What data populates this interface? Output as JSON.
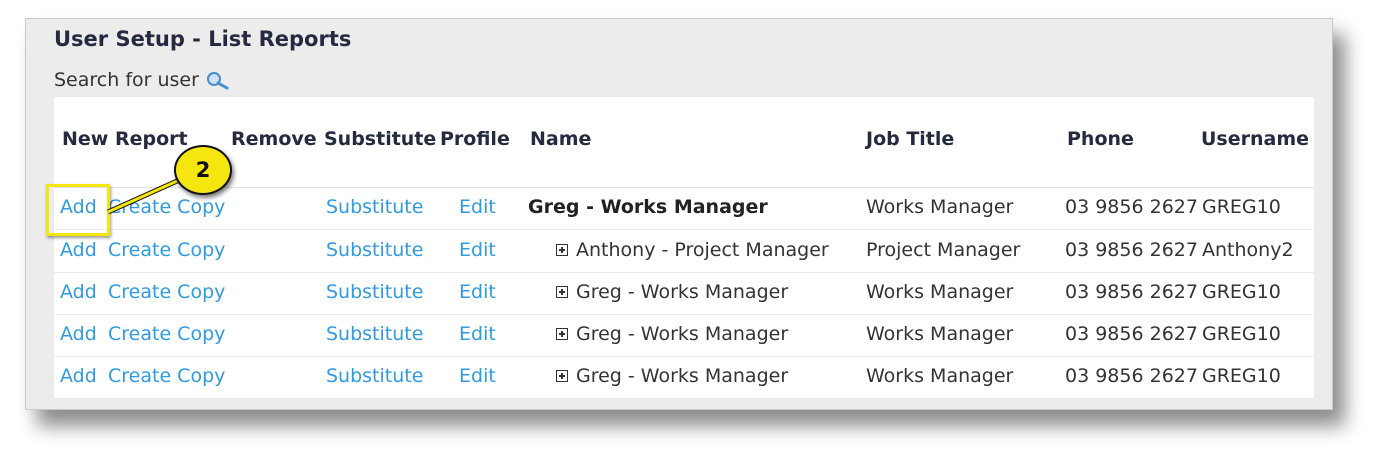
{
  "title": "User Setup - List Reports",
  "search": {
    "label": "Search for user",
    "icon": "search-icon"
  },
  "columns": [
    "New Report",
    "Remove",
    "Substitute",
    "Profile",
    "Name",
    "Job Title",
    "Phone",
    "Username"
  ],
  "rows": [
    {
      "add": "Add",
      "create_copy": "Create Copy",
      "substitute": "Substitute",
      "profile": "Edit",
      "name": "Greg - Works Manager",
      "job_title": "Works Manager",
      "phone": "03 9856 2627",
      "username": "GREG10"
    },
    {
      "add": "Add",
      "create_copy": "Create Copy",
      "substitute": "Substitute",
      "profile": "Edit",
      "name": "Anthony - Project Manager",
      "job_title": "Project Manager",
      "phone": "03 9856 2627",
      "username": "Anthony2"
    },
    {
      "add": "Add",
      "create_copy": "Create Copy",
      "substitute": "Substitute",
      "profile": "Edit",
      "name": "Greg - Works Manager",
      "job_title": "Works Manager",
      "phone": "03 9856 2627",
      "username": "GREG10"
    },
    {
      "add": "Add",
      "create_copy": "Create Copy",
      "substitute": "Substitute",
      "profile": "Edit",
      "name": "Greg - Works Manager",
      "job_title": "Works Manager",
      "phone": "03 9856 2627",
      "username": "GREG10"
    },
    {
      "add": "Add",
      "create_copy": "Create Copy",
      "substitute": "Substitute",
      "profile": "Edit",
      "name": "Greg - Works Manager",
      "job_title": "Works Manager",
      "phone": "03 9856 2627",
      "username": "GREG10"
    }
  ],
  "callout": {
    "number": "2",
    "color": "#f5e60f"
  },
  "colors": {
    "link": "#2f9be0",
    "header_text": "#262a40",
    "panel_bg": "#ececec"
  }
}
